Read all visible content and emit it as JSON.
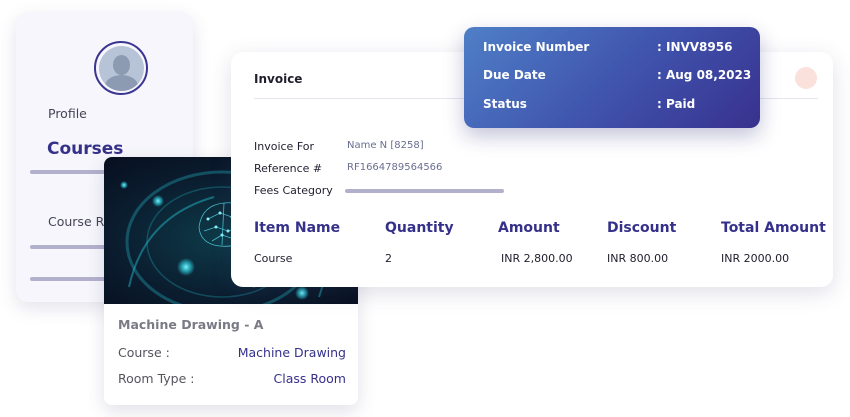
{
  "profile": {
    "label": "Profile",
    "courses_label": "Courses",
    "course_registration_label": "Course Regi"
  },
  "course_card": {
    "title": "Machine Drawing - A",
    "course_key": "Course :",
    "course_value": "Machine Drawing",
    "room_key": "Room Type :",
    "room_value": "Class Room"
  },
  "invoice": {
    "heading": "Invoice",
    "fields": {
      "invoice_for_label": "Invoice For",
      "invoice_for_value": "Name N [8258]",
      "reference_label": "Reference #",
      "reference_value": "RF1664789564566",
      "fees_category_label": "Fees Category"
    },
    "columns": [
      "Item Name",
      "Quantity",
      "Amount",
      "Discount",
      "Total Amount"
    ],
    "rows": [
      [
        "Course",
        "2",
        "INR 2,800.00",
        "INR 800.00",
        "INR 2000.00"
      ]
    ]
  },
  "summary": {
    "invoice_number_label": "Invoice Number",
    "invoice_number_value": ": INVV8956",
    "due_date_label": "Due Date",
    "due_date_value": ": Aug 08,2023",
    "status_label": "Status",
    "status_value": ": Paid"
  },
  "colors": {
    "accent": "#35318a",
    "summary_gradient_start": "#4f7fc7",
    "summary_gradient_end": "#38318d",
    "placeholder_bar": "#b3b0cc",
    "close_dot": "#fbe1dc"
  },
  "icons": {
    "avatar": "user-avatar-icon",
    "course_image": "ai-brain-illustration",
    "close": "close-dot-icon"
  }
}
